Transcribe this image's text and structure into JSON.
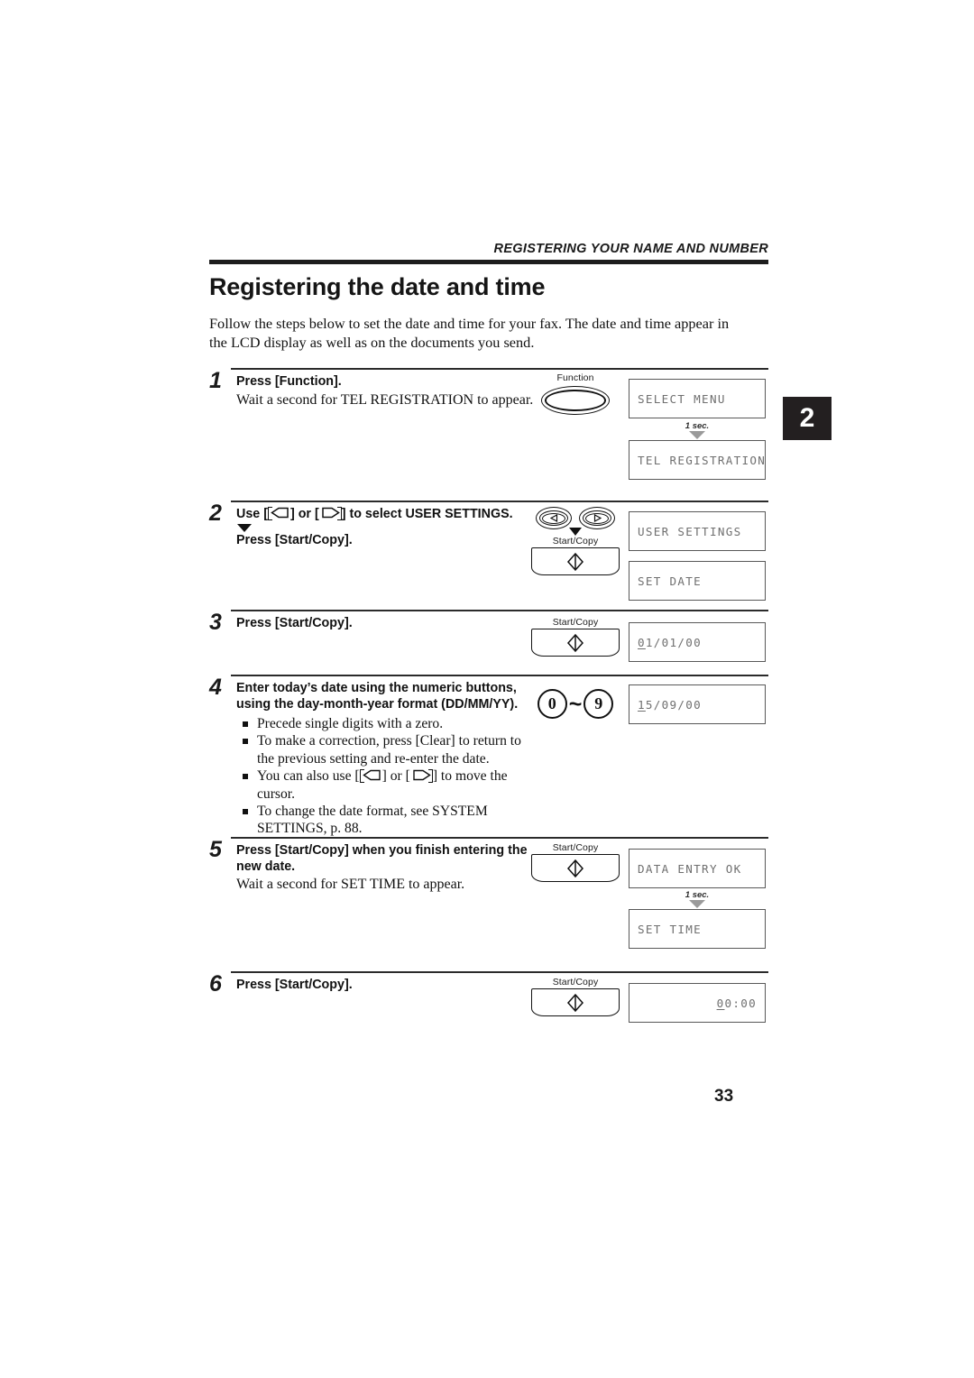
{
  "running_head": "REGISTERING YOUR NAME AND NUMBER",
  "chapter_tab": "2",
  "title": "Registering the date and time",
  "intro": "Follow the steps below to set the date and time for your fax. The date and time appear in the LCD display as well as on the documents you send.",
  "folio": "33",
  "connector_label": "1 sec.",
  "key_labels": {
    "function": "Function",
    "start_copy": "Start/Copy",
    "num_low": "0",
    "num_high": "9",
    "tilde": "~"
  },
  "steps": [
    {
      "number": "1",
      "lead": "Press [Function].",
      "sub": "Wait a second for TEL REGISTRATION to appear.",
      "lcds": [
        {
          "text": "SELECT MENU",
          "align": "left",
          "cursor": ""
        },
        {
          "text": "TEL REGISTRATION",
          "align": "left",
          "cursor": ""
        }
      ],
      "connector": "1 sec."
    },
    {
      "number": "2",
      "lead_pre": "Use [",
      "lead_mid": "] or [",
      "lead_post": "] to select USER SETTINGS.",
      "lead2": "Press [Start/Copy].",
      "lcds": [
        {
          "text": "USER SETTINGS",
          "align": "left",
          "cursor": ""
        },
        {
          "text": "SET DATE",
          "align": "left",
          "cursor": ""
        }
      ]
    },
    {
      "number": "3",
      "lead": "Press [Start/Copy].",
      "lcds": [
        {
          "cursor": "0",
          "text": "1/01/00",
          "align": "left"
        }
      ]
    },
    {
      "number": "4",
      "lead_line1": "Enter today’s date using the numeric buttons,",
      "lead_line2": "using the day-month-year format (DD/MM/YY).",
      "bullets": [
        "Precede single digits with a zero.",
        "To make a correction, press [Clear] to return to the previous setting and re-enter the date.",
        "To change the date format, see SYSTEM SETTINGS, p. 88."
      ],
      "bullet_arrow_pre": "You can also use [",
      "bullet_arrow_mid": "] or [",
      "bullet_arrow_post": "] to move the cursor.",
      "lcds": [
        {
          "cursor": "1",
          "text": "5/09/00",
          "align": "left"
        }
      ]
    },
    {
      "number": "5",
      "lead_line1": "Press [Start/Copy] when you finish entering the",
      "lead_line2": "new date.",
      "sub": "Wait a second for SET TIME to appear.",
      "lcds": [
        {
          "text": "DATA ENTRY OK",
          "align": "left",
          "cursor": ""
        },
        {
          "text": "SET TIME",
          "align": "left",
          "cursor": ""
        }
      ],
      "connector": "1 sec."
    },
    {
      "number": "6",
      "lead": "Press [Start/Copy].",
      "lcds": [
        {
          "cursor": "0",
          "text": "0:00",
          "align": "right"
        }
      ]
    }
  ]
}
